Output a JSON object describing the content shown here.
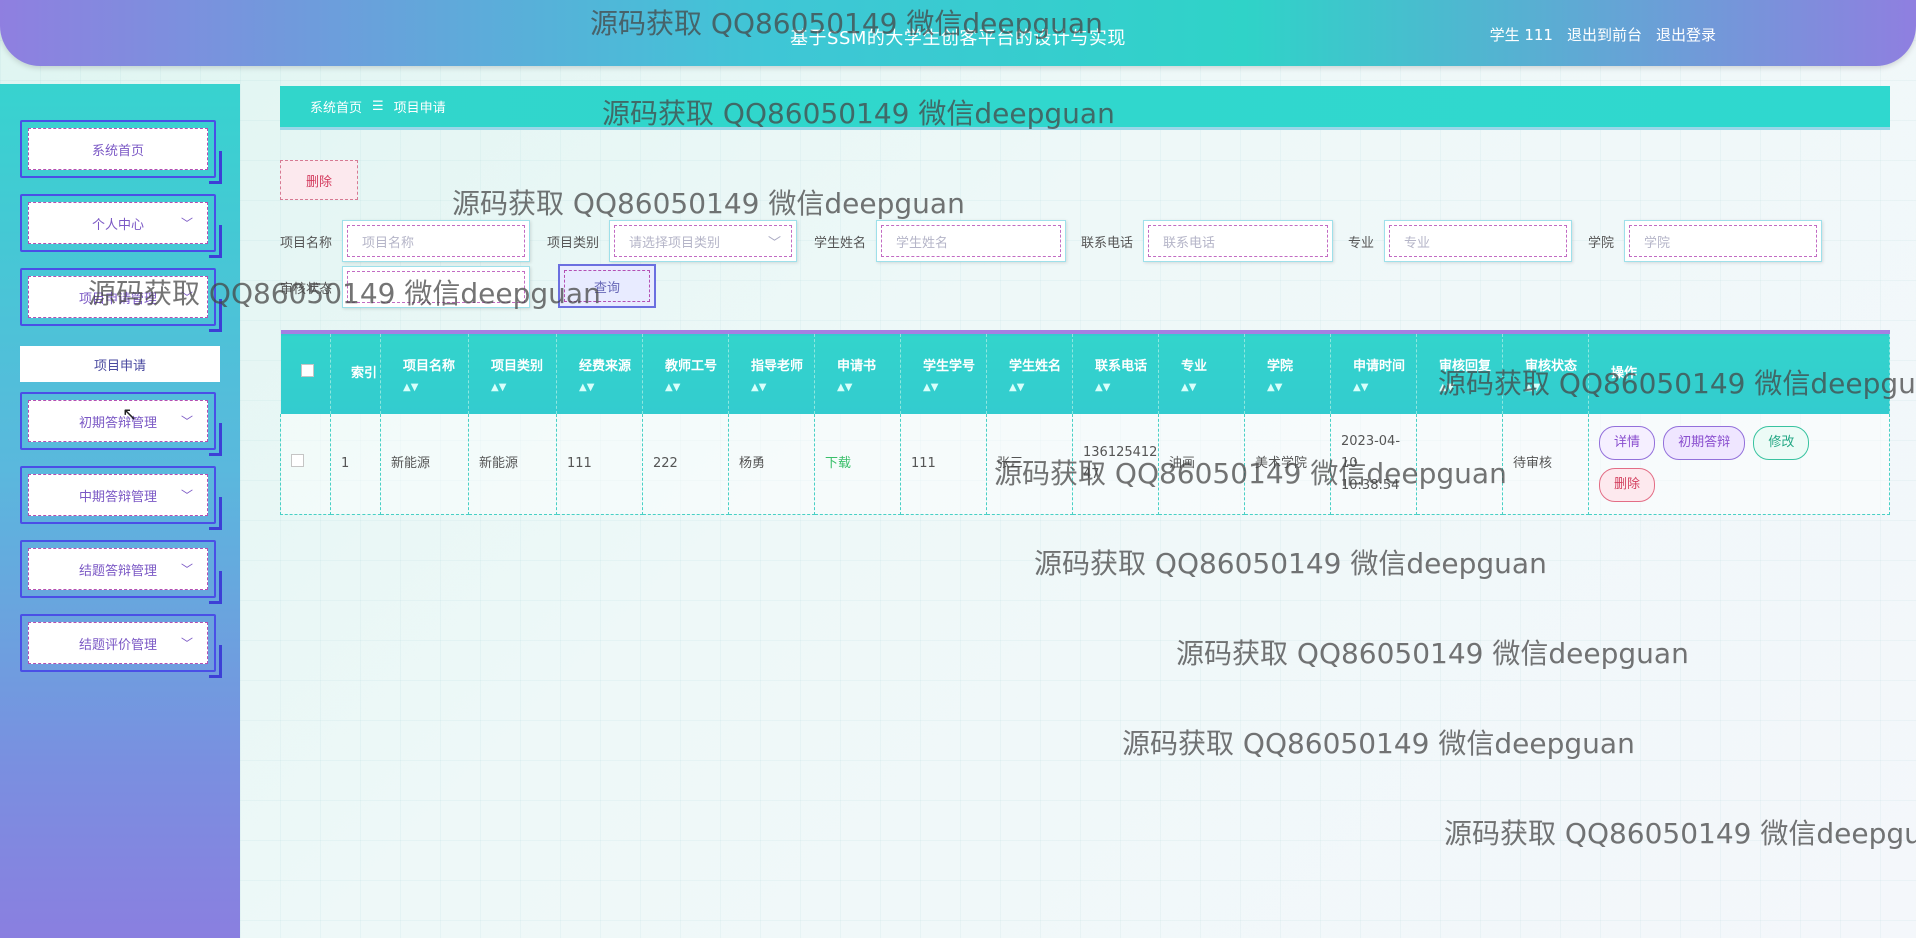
{
  "header": {
    "title": "基于SSM的大学生创客平台的设计与实现",
    "user_label": "学生 111",
    "frontend_link": "退出到前台",
    "logout_link": "退出登录"
  },
  "sidebar": {
    "items": [
      {
        "label": "系统首页",
        "has_chevron": false
      },
      {
        "label": "个人中心",
        "has_chevron": true
      },
      {
        "label": "项目申请管理",
        "has_chevron": true
      },
      {
        "label": "项目申请",
        "sub": true
      },
      {
        "label": "初期答辩管理",
        "has_chevron": true
      },
      {
        "label": "中期答辩管理",
        "has_chevron": true
      },
      {
        "label": "结题答辩管理",
        "has_chevron": true
      },
      {
        "label": "结题评价管理",
        "has_chevron": true
      }
    ]
  },
  "breadcrumb": {
    "home": "系统首页",
    "separator": "☰",
    "current": "项目申请"
  },
  "toolbar": {
    "delete_label": "删除"
  },
  "search": {
    "project_name_label": "项目名称",
    "project_name_placeholder": "项目名称",
    "project_type_label": "项目类别",
    "project_type_placeholder": "请选择项目类别",
    "student_name_label": "学生姓名",
    "student_name_placeholder": "学生姓名",
    "phone_label": "联系电话",
    "phone_placeholder": "联系电话",
    "major_label": "专业",
    "major_placeholder": "专业",
    "college_label": "学院",
    "college_placeholder": "学院",
    "audit_label": "审核状态",
    "audit_placeholder": "",
    "query_label": "查询"
  },
  "table": {
    "columns": [
      "索引",
      "项目名称",
      "项目类别",
      "经费来源",
      "教师工号",
      "指导老师",
      "申请书",
      "学生学号",
      "学生姓名",
      "联系电话",
      "专业",
      "学院",
      "申请时间",
      "审核回复",
      "审核状态",
      "操作"
    ],
    "rows": [
      {
        "index": "1",
        "project_name": "新能源",
        "project_type": "新能源",
        "funding": "111",
        "teacher_id": "222",
        "teacher": "杨勇",
        "application": "下载",
        "student_id": "111",
        "student_name": "张三",
        "phone": "13612541247",
        "major": "油画",
        "college": "美术学院",
        "apply_time": "2023-04-10 10:38:54",
        "audit_reply": "",
        "audit_status": "待审核"
      }
    ],
    "actions": {
      "detail": "详情",
      "first_defense": "初期答辩",
      "edit": "修改",
      "delete": "删除"
    }
  },
  "watermark": "源码获取 QQ86050149 微信deepguan",
  "colors": {
    "primary": "#31d6cb",
    "accent": "#8f7fe0",
    "danger": "#d33b5e"
  }
}
